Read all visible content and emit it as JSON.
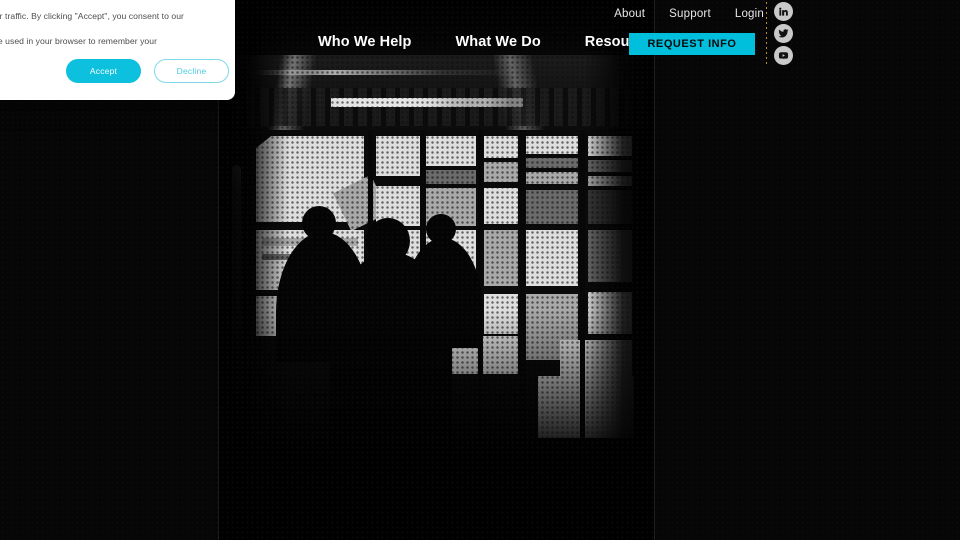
{
  "header": {
    "utility_nav": [
      {
        "label": "About"
      },
      {
        "label": "Support"
      },
      {
        "label": "Login"
      }
    ],
    "main_nav": [
      {
        "label": "Who We Help"
      },
      {
        "label": "What We Do"
      },
      {
        "label": "Resources"
      }
    ],
    "cta": {
      "label": "REQUEST INFO",
      "color": "#00bfdd"
    },
    "social": [
      {
        "name": "linkedin-icon",
        "label": "LinkedIn"
      },
      {
        "name": "twitter-icon",
        "label": "Twitter"
      },
      {
        "name": "youtube-icon",
        "label": "YouTube"
      }
    ]
  },
  "cookie_banner": {
    "line1": "d content, and analyze our traffic. By clicking \"Accept\", you consent to our",
    "line2": "site. A single cookie will be used in your browser to remember your",
    "accept_label": "Accept",
    "decline_label": "Decline",
    "accent": "#0cc0de"
  },
  "hero": {
    "image_alt": "Silhouettes of operators seated before a wall of bright monitors in a dark operations center",
    "treatment": "halftone dot overlay, black and white, high contrast"
  }
}
